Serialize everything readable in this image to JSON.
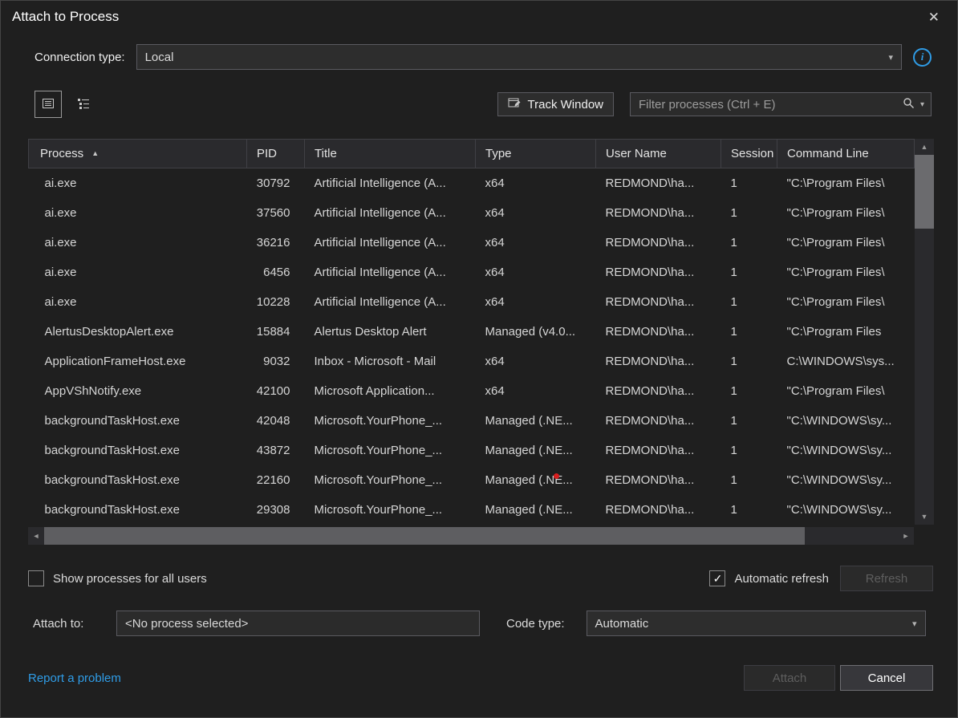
{
  "colors": {
    "accent_blue": "#2f9ce6",
    "link_blue": "#2f9ce6",
    "red_dot": "#d81e1e",
    "background": "#1f1f1f"
  },
  "window": {
    "title": "Attach to Process",
    "close_glyph": "✕"
  },
  "connection": {
    "label": "Connection type:",
    "value": "Local",
    "chevron_glyph": "▾"
  },
  "toolbar": {
    "track_window_label": "Track Window",
    "filter_placeholder": "Filter processes (Ctrl + E)",
    "filter_chevron_glyph": "▾"
  },
  "table": {
    "columns": [
      "Process",
      "PID",
      "Title",
      "Type",
      "User Name",
      "Session",
      "Command Line"
    ],
    "sort_column": "Process",
    "sort_glyph": "▲",
    "rows": [
      [
        "ai.exe",
        "30792",
        "Artificial Intelligence (A...",
        "x64",
        "REDMOND\\ha...",
        "1",
        "\"C:\\Program Files\\"
      ],
      [
        "ai.exe",
        "37560",
        "Artificial Intelligence (A...",
        "x64",
        "REDMOND\\ha...",
        "1",
        "\"C:\\Program Files\\"
      ],
      [
        "ai.exe",
        "36216",
        "Artificial Intelligence (A...",
        "x64",
        "REDMOND\\ha...",
        "1",
        "\"C:\\Program Files\\"
      ],
      [
        "ai.exe",
        "6456",
        "Artificial Intelligence (A...",
        "x64",
        "REDMOND\\ha...",
        "1",
        "\"C:\\Program Files\\"
      ],
      [
        "ai.exe",
        "10228",
        "Artificial Intelligence (A...",
        "x64",
        "REDMOND\\ha...",
        "1",
        "\"C:\\Program Files\\"
      ],
      [
        "AlertusDesktopAlert.exe",
        "15884",
        "Alertus Desktop Alert",
        "Managed (v4.0...",
        "REDMOND\\ha...",
        "1",
        "\"C:\\Program Files"
      ],
      [
        "ApplicationFrameHost.exe",
        "9032",
        "Inbox - Microsoft - Mail",
        "x64",
        "REDMOND\\ha...",
        "1",
        "C:\\WINDOWS\\sys..."
      ],
      [
        "AppVShNotify.exe",
        "42100",
        "Microsoft Application...",
        "x64",
        "REDMOND\\ha...",
        "1",
        "\"C:\\Program Files\\"
      ],
      [
        "backgroundTaskHost.exe",
        "42048",
        "Microsoft.YourPhone_...",
        "Managed (.NE...",
        "REDMOND\\ha...",
        "1",
        "\"C:\\WINDOWS\\sy..."
      ],
      [
        "backgroundTaskHost.exe",
        "43872",
        "Microsoft.YourPhone_...",
        "Managed (.NE...",
        "REDMOND\\ha...",
        "1",
        "\"C:\\WINDOWS\\sy..."
      ],
      [
        "backgroundTaskHost.exe",
        "22160",
        "Microsoft.YourPhone_...",
        "Managed (.NE...",
        "REDMOND\\ha...",
        "1",
        "\"C:\\WINDOWS\\sy..."
      ],
      [
        "backgroundTaskHost.exe",
        "29308",
        "Microsoft.YourPhone_...",
        "Managed (.NE...",
        "REDMOND\\ha...",
        "1",
        "\"C:\\WINDOWS\\sy..."
      ]
    ],
    "scrollbar_glyphs": {
      "up": "▲",
      "down": "▼",
      "left": "◄",
      "right": "►"
    }
  },
  "options": {
    "show_all_label": "Show processes for all users",
    "show_all_checked": false,
    "auto_refresh_label": "Automatic refresh",
    "auto_refresh_checked": true,
    "refresh_label": "Refresh",
    "check_glyph": "✓"
  },
  "attach": {
    "attach_to_label": "Attach to:",
    "attach_to_value": "<No process selected>",
    "code_type_label": "Code type:",
    "code_type_value": "Automatic",
    "chevron_glyph": "▾"
  },
  "footer": {
    "report_link": "Report a problem",
    "attach_label": "Attach",
    "cancel_label": "Cancel"
  }
}
